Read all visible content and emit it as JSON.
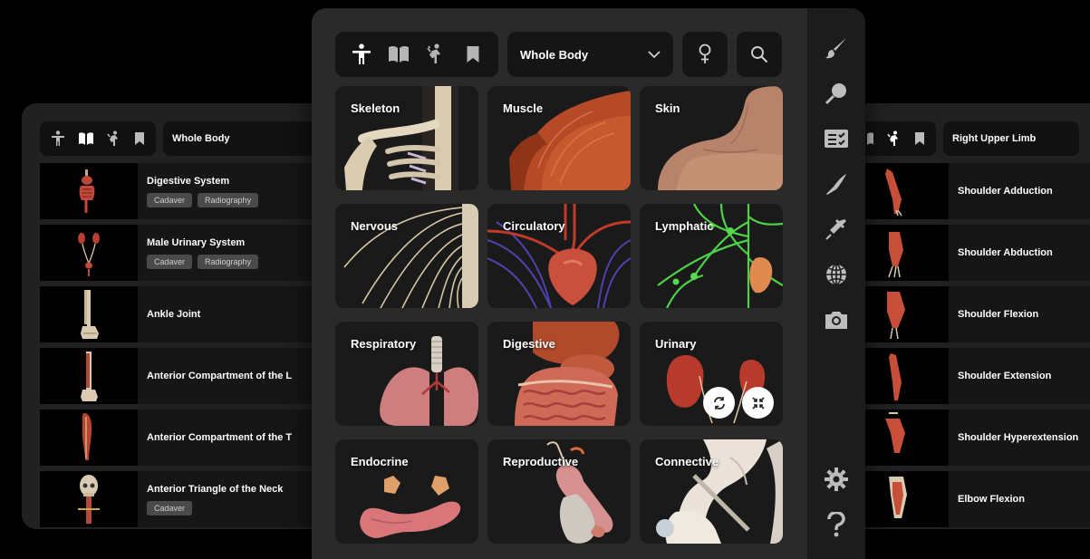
{
  "left_panel": {
    "region_label": "Whole Body",
    "items": [
      {
        "title": "Digestive System",
        "tags": [
          "Cadaver",
          "Radiography"
        ]
      },
      {
        "title": "Male Urinary System",
        "tags": [
          "Cadaver",
          "Radiography"
        ]
      },
      {
        "title": "Ankle Joint",
        "tags": []
      },
      {
        "title": "Anterior Compartment of the L",
        "tags": []
      },
      {
        "title": "Anterior Compartment of the T",
        "tags": []
      },
      {
        "title": "Anterior Triangle of the Neck",
        "tags": [
          "Cadaver"
        ]
      }
    ]
  },
  "right_panel": {
    "region_label": "Right Upper Limb",
    "items": [
      {
        "title": "Shoulder Adduction"
      },
      {
        "title": "Shoulder Abduction"
      },
      {
        "title": "Shoulder Flexion"
      },
      {
        "title": "Shoulder Extension"
      },
      {
        "title": "Shoulder Hyperextension"
      },
      {
        "title": "Elbow Flexion"
      }
    ]
  },
  "main_panel": {
    "region_label": "Whole Body",
    "systems": [
      {
        "label": "Skeleton"
      },
      {
        "label": "Muscle"
      },
      {
        "label": "Skin"
      },
      {
        "label": "Nervous"
      },
      {
        "label": "Circulatory"
      },
      {
        "label": "Lymphatic"
      },
      {
        "label": "Respiratory"
      },
      {
        "label": "Digestive"
      },
      {
        "label": "Urinary"
      },
      {
        "label": "Endocrine"
      },
      {
        "label": "Reproductive"
      },
      {
        "label": "Connective"
      }
    ]
  },
  "icons": {
    "main_modes": [
      "body-icon",
      "book-icon",
      "movement-icon",
      "bookmark-icon"
    ],
    "rail": [
      "brush-icon",
      "magnifier-icon",
      "quiz-icon",
      "scalpel-icon",
      "syringe-icon",
      "globe-icon",
      "camera-icon",
      "gear-icon",
      "help-icon"
    ]
  },
  "colors": {
    "panel_bg": "#2a2a2a",
    "side_panel_bg": "#212121",
    "control_bg": "#151515",
    "tag_bg": "#4a4a4a"
  }
}
